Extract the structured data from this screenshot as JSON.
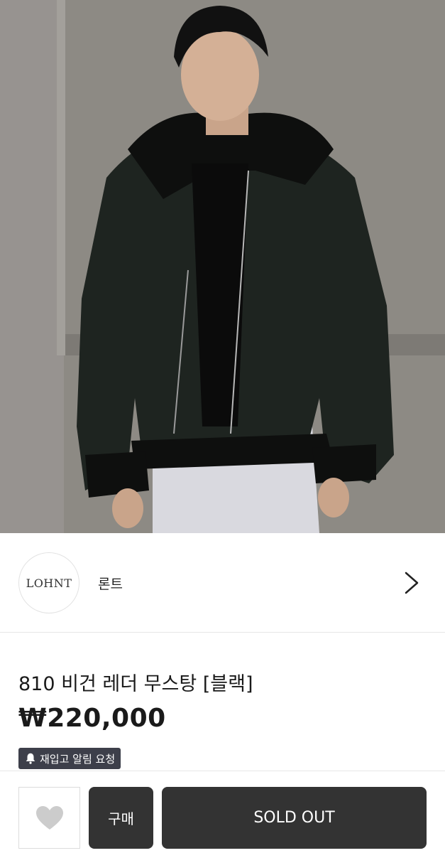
{
  "hero": {
    "image_label": "product-photo"
  },
  "brand": {
    "logo_text": "LOHNT",
    "name": "론트"
  },
  "product": {
    "title": "810 비건 레더 무스탕 [블랙]",
    "price": "₩220,000",
    "restock_label": "재입고 알림 요청"
  },
  "actions": {
    "buy_label": "구매",
    "soldout_label": "SOLD OUT"
  },
  "colors": {
    "dark_button": "#333333",
    "badge": "#3d3f4a",
    "like_icon": "#cccccc"
  },
  "icons": {
    "chevron": "chevron-right-icon",
    "bell": "bell-icon",
    "heart": "heart-icon"
  }
}
